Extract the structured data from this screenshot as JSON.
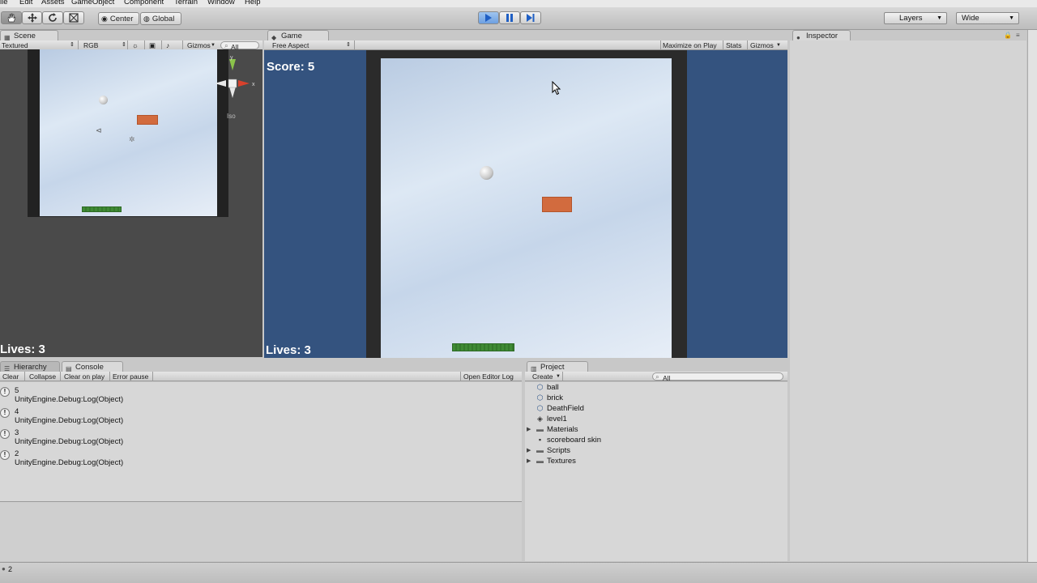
{
  "menu": [
    "ile",
    "Edit",
    "Assets",
    "GameObject",
    "Component",
    "Terrain",
    "Window",
    "Help"
  ],
  "toolbar": {
    "center_label": "Center",
    "global_label": "Global",
    "layers_label": "Layers",
    "layout_label": "Wide"
  },
  "scene": {
    "tab_label": "Scene",
    "render_mode": "Textured",
    "color_mode": "RGB",
    "gizmos_label": "Gizmos",
    "search_placeholder": "All",
    "iso_label": "Iso",
    "lives_text": "Lives: 3"
  },
  "game": {
    "tab_label": "Game",
    "aspect": "Free Aspect",
    "maximize_label": "Maximize on Play",
    "stats_label": "Stats",
    "gizmos_label": "Gizmos",
    "score_text": "Score: 5",
    "lives_text": "Lives: 3"
  },
  "inspector": {
    "tab_label": "Inspector"
  },
  "hierarchy": {
    "tab_label": "Hierarchy"
  },
  "console": {
    "tab_label": "Console",
    "buttons": [
      "Clear",
      "Collapse",
      "Clear on play",
      "Error pause"
    ],
    "open_log_label": "Open Editor Log",
    "entries": [
      {
        "value": "5",
        "message": "UnityEngine.Debug:Log(Object)"
      },
      {
        "value": "4",
        "message": "UnityEngine.Debug:Log(Object)"
      },
      {
        "value": "3",
        "message": "UnityEngine.Debug:Log(Object)"
      },
      {
        "value": "2",
        "message": "UnityEngine.Debug:Log(Object)"
      }
    ]
  },
  "project": {
    "tab_label": "Project",
    "create_label": "Create",
    "search_placeholder": "All",
    "items": [
      {
        "label": "ball",
        "icon": "prefab-icon",
        "folder": false
      },
      {
        "label": "brick",
        "icon": "prefab-icon",
        "folder": false
      },
      {
        "label": "DeathField",
        "icon": "prefab-icon",
        "folder": false
      },
      {
        "label": "level1",
        "icon": "unity-scene-icon",
        "folder": false
      },
      {
        "label": "Materials",
        "icon": "folder-icon",
        "folder": true
      },
      {
        "label": "scoreboard skin",
        "icon": "guiskin-icon",
        "folder": false
      },
      {
        "label": "Scripts",
        "icon": "folder-icon",
        "folder": true
      },
      {
        "label": "Textures",
        "icon": "folder-icon",
        "folder": true
      }
    ]
  },
  "status": {
    "text": "2"
  }
}
